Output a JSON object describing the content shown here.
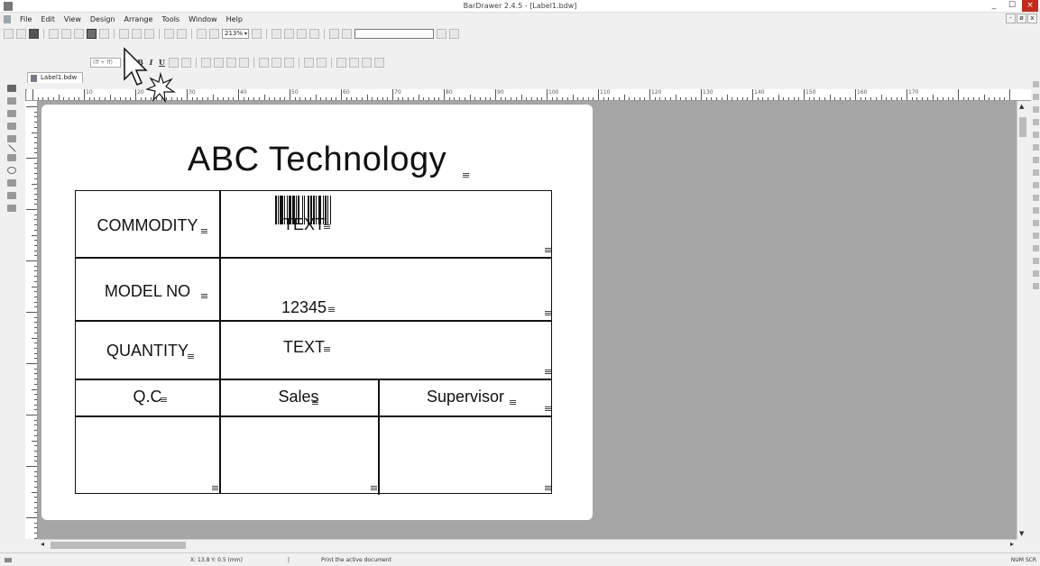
{
  "window": {
    "title": "BarDrawer 2.4.5 - [Label1.bdw]",
    "buttons": [
      "_",
      "☐",
      "×"
    ]
  },
  "menubar": {
    "items": [
      "File",
      "Edit",
      "View",
      "Design",
      "Arrange",
      "Tools",
      "Window",
      "Help"
    ],
    "mdi_buttons": [
      "-",
      "ø",
      "x"
    ]
  },
  "toolbar": {
    "zoom_value": "213%",
    "font_size_placeholder": "(ff + ff)",
    "format_glyphs": [
      "B",
      "I",
      "U"
    ]
  },
  "document_tab": {
    "label": "Label1.bdw"
  },
  "ruler": {
    "labels": [
      "10",
      "20",
      "30",
      "40",
      "50",
      "60",
      "70",
      "80",
      "90",
      "100",
      "110",
      "120",
      "130",
      "140",
      "150",
      "160",
      "170"
    ]
  },
  "label": {
    "title": "ABC Technology",
    "rows": [
      {
        "name": "COMMODITY",
        "value": "TEXT"
      },
      {
        "name": "MODEL NO",
        "value": "12345"
      },
      {
        "name": "QUANTITY",
        "value": "TEXT"
      }
    ],
    "footer": [
      "Q.C",
      "Sales",
      "Supervisor"
    ]
  },
  "statusbar": {
    "coords": "X: 13.8  Y: 0.5 (mm)",
    "message": "Print the active document",
    "indicators": "NUM  SCR"
  },
  "colors": {
    "canvas": "#a5a5a5",
    "close_button": "#c42b1c"
  }
}
